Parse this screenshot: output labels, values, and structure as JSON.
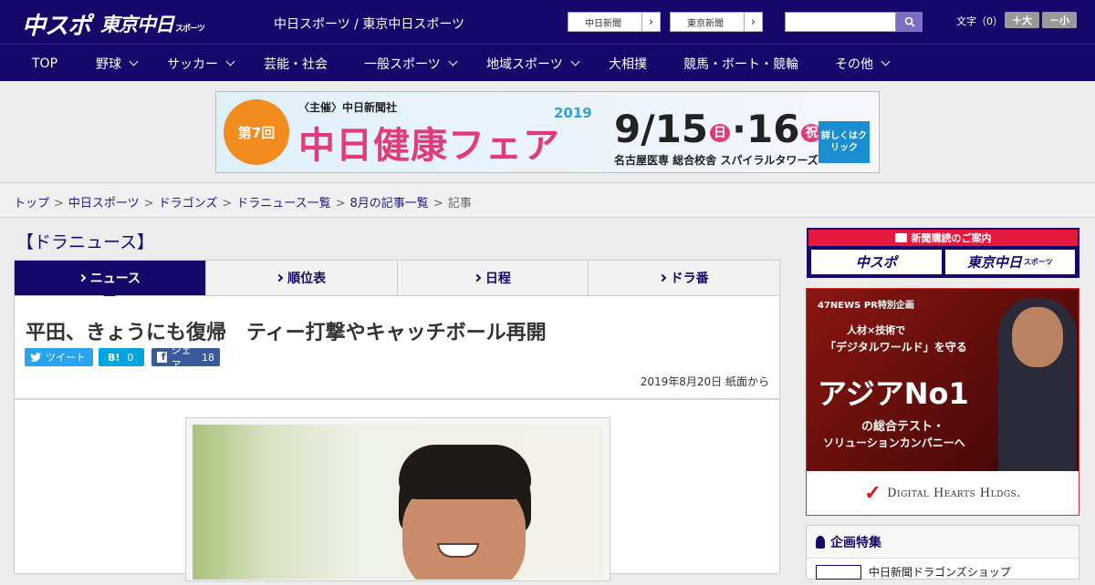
{
  "header": {
    "logo_chuspo": "中スポ",
    "logo_tokyo": "東京中日",
    "logo_tokyo_sub": "スポーツ",
    "site_name": "中日スポーツ / 東京中日スポーツ",
    "paper_buttons": [
      "中日新聞",
      "東京新聞"
    ],
    "search": {
      "placeholder": ""
    },
    "font_label": "文字（0）",
    "font_larger": "＋大",
    "font_smaller": "－小"
  },
  "nav": {
    "items": [
      {
        "label": "TOP",
        "dropdown": false
      },
      {
        "label": "野球",
        "dropdown": true
      },
      {
        "label": "サッカー",
        "dropdown": true
      },
      {
        "label": "芸能・社会",
        "dropdown": false
      },
      {
        "label": "一般スポーツ",
        "dropdown": true
      },
      {
        "label": "地域スポーツ",
        "dropdown": true
      },
      {
        "label": "大相撲",
        "dropdown": false
      },
      {
        "label": "競馬・ボート・競輪",
        "dropdown": false
      },
      {
        "label": "その他",
        "dropdown": true
      }
    ]
  },
  "banner": {
    "badge": "第7回",
    "host": "〈主催〉中日新聞社",
    "title": "中日健康フェア",
    "year": "2019",
    "dates": "9/15",
    "dates_2": "16",
    "dates_day1": "日",
    "dates_day2": "祝",
    "venue": "名古屋医専 総合校舎 スパイラルタワーズ",
    "cta": "詳しくはクリック"
  },
  "breadcrumb": {
    "items": [
      "トップ",
      "中日スポーツ",
      "ドラゴンズ",
      "ドラニュース一覧",
      "8月の記事一覧"
    ],
    "current": "記事",
    "separator": ">"
  },
  "section_title": "【ドラニュース】",
  "tabs": [
    {
      "label": "ニュース",
      "active": true
    },
    {
      "label": "順位表",
      "active": false
    },
    {
      "label": "日程",
      "active": false
    },
    {
      "label": "ドラ番",
      "active": false
    }
  ],
  "article": {
    "headline": "平田、きょうにも復帰　ティー打撃やキャッチボール再開",
    "share": {
      "tweet_label": "ツイート",
      "hatena_label": "B!",
      "hatena_count": "0",
      "fb_label": "シェア",
      "fb_count": "18"
    },
    "date_line": "2019年8月20日 紙面から"
  },
  "sidebar": {
    "subscribe_head": "新聞購読のご案内",
    "subscribe_btn1": "中スポ",
    "subscribe_btn2": "東京中日",
    "subscribe_btn2_sub": "スポーツ",
    "ad": {
      "tag": "47NEWS PR特別企画",
      "line1": "人材×技術で",
      "line2": "「デジタルワールド」を守る",
      "big": "アジアNo1",
      "line3": "の総合テスト・",
      "line4": "ソリューションカンパニーへ",
      "brand": "Digital Hearts Hldgs."
    },
    "features_title": "企画特集",
    "features_item": "中日新聞ドラゴンズショップ"
  },
  "colors": {
    "brand_navy": "#16086a",
    "accent_red": "#e5193e",
    "twitter": "#2aa3ef",
    "hatena": "#00a4de",
    "facebook": "#3b5a99"
  }
}
